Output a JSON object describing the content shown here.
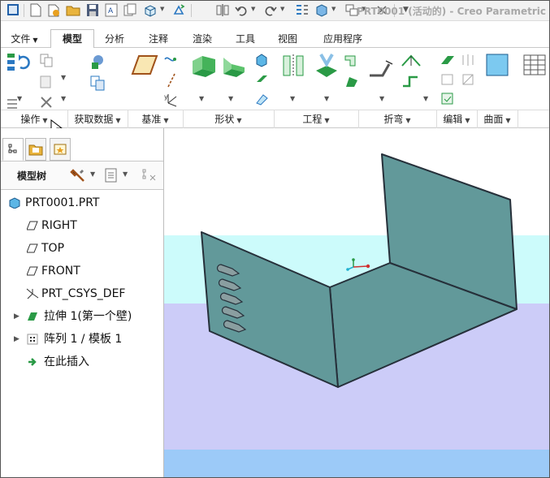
{
  "window": {
    "title": "PRT0001 (活动的) - Creo Parametric"
  },
  "quick_access": {
    "icons": [
      "window-icon",
      "new-icon",
      "open-icon",
      "open-folder-icon",
      "save-icon",
      "print-icon",
      "copy-icon",
      "cube-icon",
      "regenerate-icon",
      "mirror-icon",
      "undo-icon",
      "redo-icon",
      "regen-list-icon",
      "view-icon",
      "windows-icon",
      "close-icon",
      "more-icon"
    ]
  },
  "tabs": [
    {
      "label": "文件",
      "has_dropdown": true
    },
    {
      "label": "模型",
      "active": true
    },
    {
      "label": "分析"
    },
    {
      "label": "注释"
    },
    {
      "label": "渲染"
    },
    {
      "label": "工具"
    },
    {
      "label": "视图"
    },
    {
      "label": "应用程序"
    }
  ],
  "ribbon": {
    "groups": [
      {
        "label": "操作"
      },
      {
        "label": "获取数据"
      },
      {
        "label": "基准"
      },
      {
        "label": "形状"
      },
      {
        "label": "工程"
      },
      {
        "label": "折弯"
      },
      {
        "label": "编辑"
      },
      {
        "label": "曲面"
      }
    ]
  },
  "left_pane": {
    "model_tree_label": "模型树",
    "items": [
      {
        "label": "PRT0001.PRT",
        "icon": "part-icon"
      },
      {
        "label": "RIGHT",
        "icon": "datum-plane-icon"
      },
      {
        "label": "TOP",
        "icon": "datum-plane-icon"
      },
      {
        "label": "FRONT",
        "icon": "datum-plane-icon"
      },
      {
        "label": "PRT_CSYS_DEF",
        "icon": "csys-icon"
      },
      {
        "label": "拉伸 1(第一个壁)",
        "icon": "extrude-wall-icon",
        "expandable": true
      },
      {
        "label": "阵列 1 / 模板 1",
        "icon": "pattern-icon",
        "expandable": true
      },
      {
        "label": "在此插入",
        "icon": "insert-here-arrow-icon"
      }
    ]
  },
  "colors": {
    "sheet_metal": "#62999a",
    "sheet_edge": "#26303a",
    "bg_cyan": "#ccfbfb",
    "bg_lavender": "#ccccf8",
    "bg_blue": "#9ccaf8",
    "accent_green": "#2a9a46"
  }
}
